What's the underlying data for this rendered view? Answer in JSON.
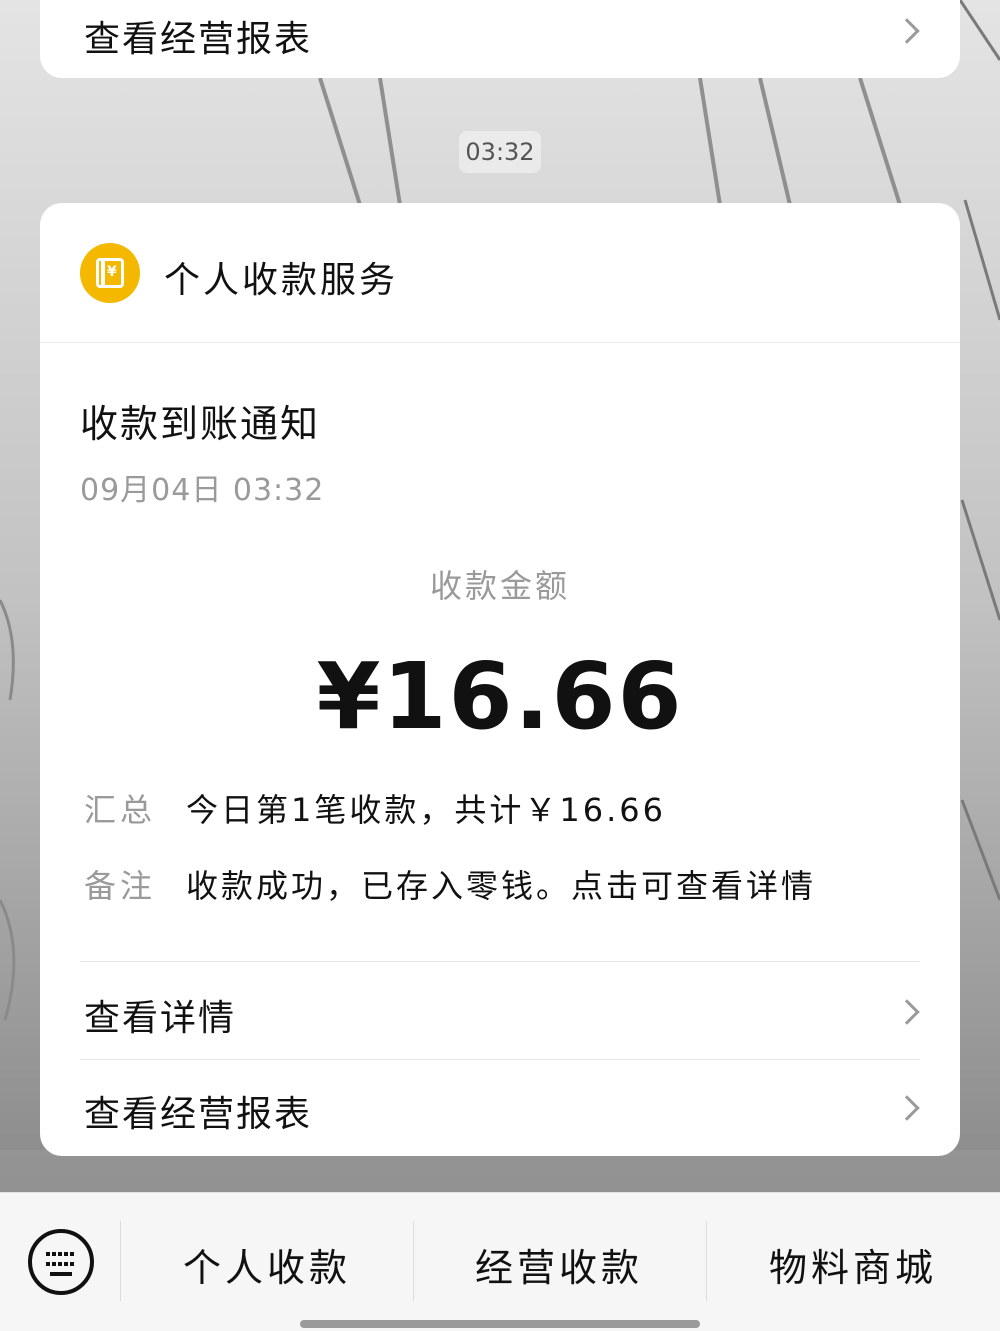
{
  "previous_card": {
    "link_label": "查看经营报表",
    "chevron_icon": "chevron-right-icon"
  },
  "timestamp": "03:32",
  "service": {
    "icon": "wallet-yen-icon",
    "icon_color": "#F5B800",
    "name": "个人收款服务"
  },
  "notice": {
    "title": "收款到账通知",
    "date": "09月04日  03:32",
    "amount_label": "收款金额",
    "amount": "¥16.66",
    "summary_key": "汇总",
    "summary_value": "今日第1笔收款，共计￥16.66",
    "remark_key": "备注",
    "remark_value": "收款成功，已存入零钱。点击可查看详情",
    "link_details": "查看详情",
    "link_report": "查看经营报表"
  },
  "bottom_menu": {
    "keyboard_icon": "keyboard-icon",
    "items": [
      "个人收款",
      "经营收款",
      "物料商城"
    ]
  }
}
